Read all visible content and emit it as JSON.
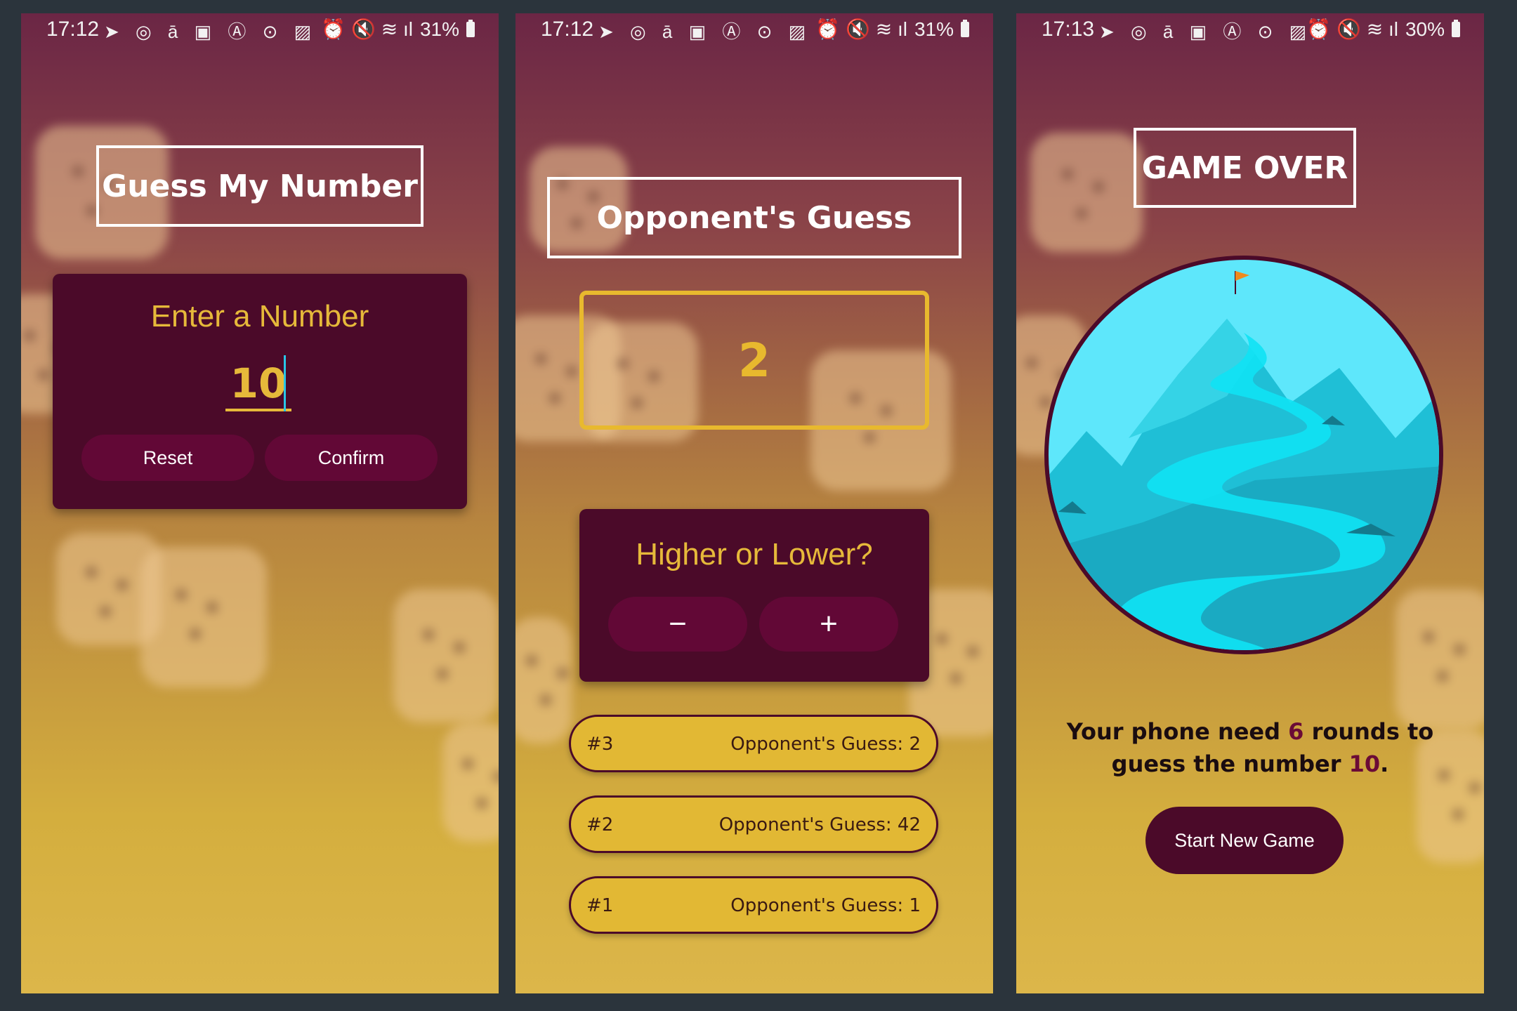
{
  "screens": [
    {
      "status": {
        "time": "17:12",
        "battery": "31%"
      },
      "title": "Guess My Number",
      "card": {
        "title": "Enter a Number",
        "input_value": "10",
        "reset_label": "Reset",
        "confirm_label": "Confirm"
      }
    },
    {
      "status": {
        "time": "17:12",
        "battery": "31%"
      },
      "title": "Opponent's Guess",
      "current_guess": "2",
      "card": {
        "title": "Higher or Lower?",
        "minus_label": "−",
        "plus_label": "+"
      },
      "log": [
        {
          "round": "#3",
          "text": "Opponent's Guess: 2"
        },
        {
          "round": "#2",
          "text": "Opponent's Guess: 42"
        },
        {
          "round": "#1",
          "text": "Opponent's Guess: 1"
        }
      ]
    },
    {
      "status": {
        "time": "17:13",
        "battery": "30%"
      },
      "title": "GAME OVER",
      "summary": {
        "part1": "Your phone need ",
        "rounds": "6",
        "part2": " rounds to guess the number ",
        "number": "10",
        "part3": "."
      },
      "start_label": "Start New Game"
    }
  ],
  "colors": {
    "card": "#4b0a29",
    "accent": "#e6b93a",
    "button": "#620836",
    "log_item": "#e2b834"
  }
}
